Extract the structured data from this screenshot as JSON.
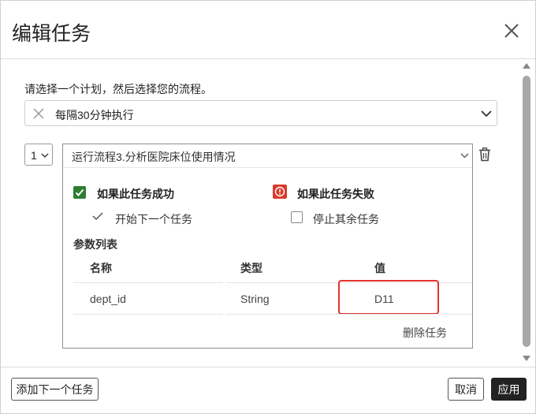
{
  "dialog": {
    "title": "编辑任务"
  },
  "plan": {
    "instruction": "请选择一个计划，然后选择您的流程。",
    "selected": "每隔30分钟执行"
  },
  "task": {
    "step_number": "1",
    "flow": "运行流程3.分析医院床位使用情况",
    "on_success": {
      "label": "如果此任务成功",
      "option_label": "开始下一个任务"
    },
    "on_failure": {
      "label": "如果此任务失败",
      "option_label": "停止其余任务",
      "checked": false
    },
    "params": {
      "title": "参数列表",
      "headers": [
        "名称",
        "类型",
        "值"
      ],
      "rows": [
        {
          "name": "dept_id",
          "type": "String",
          "value": "D11"
        }
      ]
    },
    "delete_label": "删除任务"
  },
  "footer": {
    "add_next_label": "添加下一个任务",
    "cancel_label": "取消",
    "apply_label": "应用"
  },
  "colors": {
    "success": "#2e7d32",
    "failure": "#d83a2a",
    "highlight": "#e5322a",
    "primary_button": "#222222"
  },
  "icons": {
    "close": "close-icon",
    "clear": "clear-x-icon",
    "dropdown": "chevron-down-icon",
    "delete": "trash-icon",
    "check": "check-icon",
    "alert": "alert-icon"
  }
}
